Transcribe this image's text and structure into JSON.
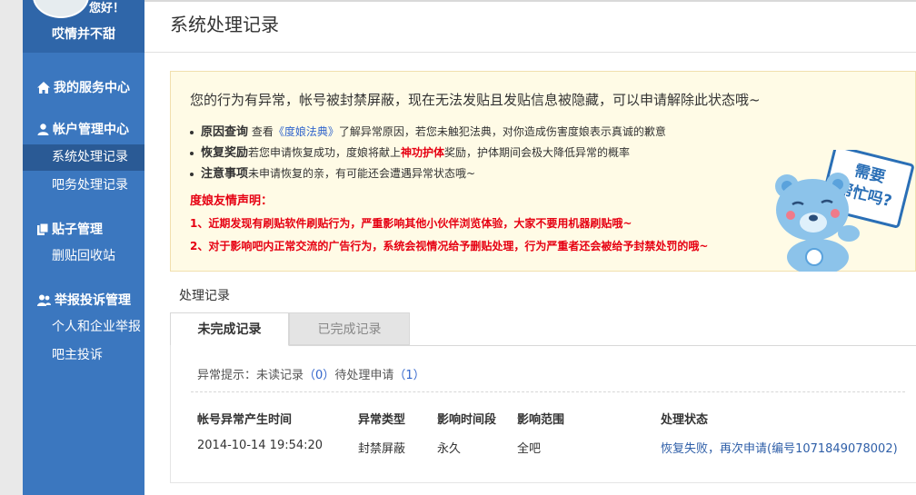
{
  "sidebar": {
    "greeting": "您好！",
    "username": "哎情并不甜",
    "sections": [
      {
        "title": "我的服务中心",
        "icon": "home-icon",
        "items": []
      },
      {
        "title": "帐户管理中心",
        "icon": "user-icon",
        "items": [
          {
            "label": "系统处理记录",
            "active": true
          },
          {
            "label": "吧务处理记录",
            "active": false
          }
        ]
      },
      {
        "title": "贴子管理",
        "icon": "document-icon",
        "items": [
          {
            "label": "删贴回收站",
            "active": false
          }
        ]
      },
      {
        "title": "举报投诉管理",
        "icon": "users-icon",
        "items": [
          {
            "label": "个人和企业举报",
            "active": false
          },
          {
            "label": "吧主投诉",
            "active": false
          }
        ]
      }
    ]
  },
  "header": {
    "title": "系统处理记录"
  },
  "notice": {
    "headline": "您的行为有异常，帐号被封禁屏蔽，现在无法发贴且发贴信息被隐藏，可以申请解除此状态哦~",
    "bullets": [
      {
        "bold": "原因查询",
        "pre": " 查看",
        "link": "《度娘法典》",
        "post": "了解异常原因，若您未触犯法典，对你造成伤害度娘表示真诚的歉意"
      },
      {
        "bold": "恢复奖励",
        "pre": "若您申请恢复成功，度娘将献上",
        "red": "神功护体",
        "post": "奖励，护体期间会极大降低异常的概率"
      },
      {
        "bold": "注意事项",
        "pre": "未申请恢复的亲，有可能还会遭遇异常状态哦~"
      }
    ],
    "statement_title": "度娘友情声明：",
    "statements": [
      "1、近期发现有刷贴软件刷贴行为，严重影响其他小伙伴浏览体验，大家不要用机器刷贴哦~",
      "2、对于影响吧内正常交流的广告行为，系统会视情况给予删贴处理，行为严重者还会被给予封禁处罚的哦~"
    ],
    "mascot_sign": [
      "需要",
      "帮忙吗?"
    ]
  },
  "records": {
    "section_label": "处理记录",
    "tabs": [
      {
        "label": "未完成记录",
        "active": true
      },
      {
        "label": "已完成记录",
        "active": false
      }
    ],
    "hint": {
      "label": "异常提示：",
      "unread_label": "未读记录",
      "unread_count": "（0）",
      "pending_label": "待处理申请",
      "pending_count": "（1）"
    },
    "columns": [
      "帐号异常产生时间",
      "异常类型",
      "影响时间段",
      "影响范围",
      "处理状态"
    ],
    "rows": [
      {
        "time": "2014-10-14 19:54:20",
        "type": "封禁屏蔽",
        "duration": "永久",
        "scope": "全吧",
        "status": "恢复失败，再次申请(编号1071849078002)"
      }
    ]
  },
  "colors": {
    "sidebar": "#3b77bf",
    "sidebar_active": "#2a5a95",
    "notice_bg": "#fffbe6",
    "alert": "#e60012",
    "link": "#3366cc"
  }
}
